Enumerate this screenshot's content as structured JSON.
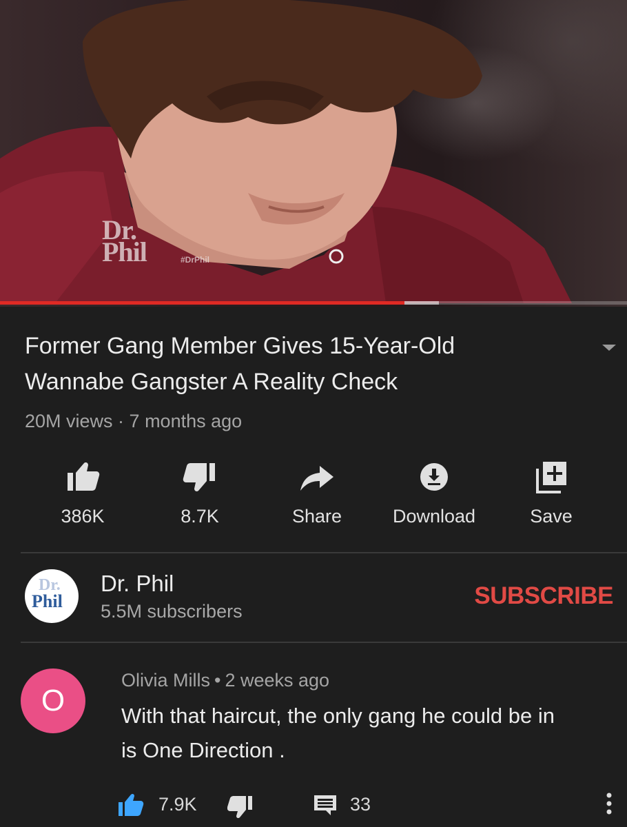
{
  "video": {
    "watermark_logo_line1": "Dr.",
    "watermark_logo_line2": "Phil",
    "watermark_hashtag": "#DrPhil",
    "progress_played_fraction": 0.645,
    "progress_buffered_fraction": 0.7,
    "colors": {
      "progress": "#e02a24"
    }
  },
  "title": {
    "line1": "Former Gang Member Gives 15-Year-Old",
    "line2": "Wannabe Gangster A Reality Check"
  },
  "meta": {
    "views": "20M views",
    "separator": " · ",
    "age": "7 months ago"
  },
  "actions": [
    {
      "icon": "thumb-up-icon",
      "label": "386K"
    },
    {
      "icon": "thumb-down-icon",
      "label": "8.7K"
    },
    {
      "icon": "share-icon",
      "label": "Share"
    },
    {
      "icon": "download-icon",
      "label": "Download"
    },
    {
      "icon": "save-playlist-icon",
      "label": "Save"
    }
  ],
  "channel": {
    "avatar_line1": "Dr.",
    "avatar_line2": "Phil",
    "name": "Dr. Phil",
    "subscribers": "5.5M subscribers",
    "subscribe_label": "SUBSCRIBE",
    "subscribe_color": "#e14a45"
  },
  "comment": {
    "avatar_letter": "O",
    "avatar_color": "#ea4f86",
    "author": "Olivia Mills",
    "separator": "•",
    "age": "2 weeks ago",
    "text_line1": "With that haircut, the only gang he could be in",
    "text_line2": "is One Direction .",
    "likes": "7.9K",
    "replies": "33",
    "like_color": "#3ea6ff"
  }
}
